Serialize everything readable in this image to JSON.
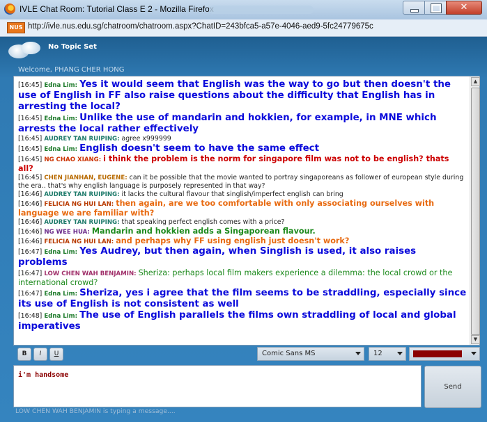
{
  "window": {
    "title": "IVLE Chat Room: Tutorial Class E 2 - Mozilla Firefox"
  },
  "address": {
    "site_badge": "NUS",
    "url": "http://ivle.nus.edu.sg/chatroom/chatroom.aspx?ChatID=243bfca5-a57e-4046-aed9-5fc24779675c"
  },
  "header": {
    "topic": "No Topic Set",
    "welcome": "Welcome, PHANG CHER HONG"
  },
  "messages": [
    {
      "time": "[16:45]",
      "name": "Edna Lim:",
      "text": "Yes it would seem that English was the way to go but then doesn't the use of English in FF also raise questions about the difficulty that English has in arresting the local?",
      "color": "#0a0adb",
      "name_color": "#1d7a2a",
      "style": "big"
    },
    {
      "time": "[16:45]",
      "name": "Edna Lim:",
      "text": "Unlike the use of mandarin and hokkien, for example, in MNE which arrests the local rather effectively",
      "color": "#0a0adb",
      "name_color": "#1d7a2a",
      "style": "big"
    },
    {
      "time": "[16:45]",
      "name": "AUDREY TAN RUIPING:",
      "text": "agree x999999",
      "color": "#222222",
      "name_color": "#1d7a6a",
      "style": "small"
    },
    {
      "time": "[16:45]",
      "name": "Edna Lim:",
      "text": "English doesn't seem to have the same effect",
      "color": "#0a0adb",
      "name_color": "#1d7a2a",
      "style": "big"
    },
    {
      "time": "[16:45]",
      "name": "NG CHAO XIANG:",
      "text": "i think the problem is the norm for singapore film was not to be english? thats all?",
      "color": "#cc0000",
      "name_color": "#cc3300",
      "style": "med"
    },
    {
      "time": "[16:45]",
      "name": "CHEN JIANHAN, EUGENE:",
      "text": "can it be possible that the movie wanted to portray singaporeans as follower of european style during the era.. that's why english language is purposely represented in that way?",
      "color": "#222222",
      "name_color": "#b86a00",
      "style": "small"
    },
    {
      "time": "[16:46]",
      "name": "AUDREY TAN RUIPING:",
      "text": "it lacks the cultural flavour that singlish/imperfect english can bring",
      "color": "#222222",
      "name_color": "#1d7a6a",
      "style": "small"
    },
    {
      "time": "[16:46]",
      "name": "FELICIA NG HUI LAN:",
      "text": "then again, are we too comfortable with only associating ourselves with language we are familiar with?",
      "color": "#e86a10",
      "name_color": "#b83a00",
      "style": "med"
    },
    {
      "time": "[16:46]",
      "name": "AUDREY TAN RUIPING:",
      "text": "that speaking perfect english comes with a price?",
      "color": "#222222",
      "name_color": "#1d7a6a",
      "style": "small"
    },
    {
      "time": "[16:46]",
      "name": "NG WEE HUA:",
      "text": "Mandarin and hokkien adds a Singaporean flavour.",
      "color": "#1d8a1d",
      "name_color": "#6a2a8a",
      "style": "med"
    },
    {
      "time": "[16:46]",
      "name": "FELICIA NG HUI LAN:",
      "text": "and perhaps why FF using english just doesn't work?",
      "color": "#e86a10",
      "name_color": "#b83a00",
      "style": "med"
    },
    {
      "time": "[16:47]",
      "name": "Edna Lim:",
      "text": "Yes Audrey, but then again, when Singlish is used, it also raises problems",
      "color": "#0a0adb",
      "name_color": "#1d7a2a",
      "style": "big"
    },
    {
      "time": "[16:47]",
      "name": "LOW CHEN WAH BENJAMIN:",
      "text": "Sheriza: perhaps local film makers experience a dilemma: the local crowd or the international crowd?",
      "color": "#1d8a1d",
      "name_color": "#a0306a",
      "style": "medn"
    },
    {
      "time": "[16:47]",
      "name": "Edna Lim:",
      "text": "Sheriza, yes i agree that the film seems to be straddling, especially since its use of English is not consistent as well",
      "color": "#0a0adb",
      "name_color": "#1d7a2a",
      "style": "big"
    },
    {
      "time": "[16:48]",
      "name": "Edna Lim:",
      "text": "The use of English parallels the films own straddling of local and global imperatives",
      "color": "#0a0adb",
      "name_color": "#1d7a2a",
      "style": "big"
    }
  ],
  "toolbar": {
    "bold": "B",
    "italic": "I",
    "underline": "U",
    "font": "Comic Sans MS",
    "size": "12",
    "text_color": "#8b0000"
  },
  "compose": {
    "value": "i'm handsome",
    "send_label": "Send"
  },
  "status": {
    "typing": "LOW CHEN WAH BENJAMIN is typing a message...."
  }
}
